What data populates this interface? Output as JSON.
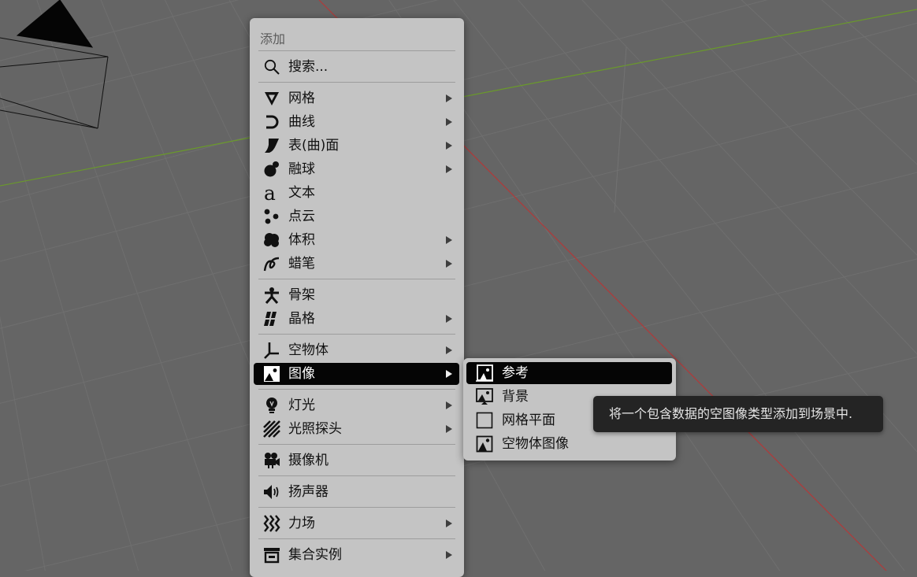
{
  "menu": {
    "title": "添加",
    "search_label": "搜索...",
    "items": [
      {
        "label": "网格",
        "icon": "mesh-icon",
        "has_submenu": true
      },
      {
        "label": "曲线",
        "icon": "curve-icon",
        "has_submenu": true
      },
      {
        "label": "表(曲)面",
        "icon": "surface-icon",
        "has_submenu": true
      },
      {
        "label": "融球",
        "icon": "metaball-icon",
        "has_submenu": true
      },
      {
        "label": "文本",
        "icon": "text-icon",
        "has_submenu": false
      },
      {
        "label": "点云",
        "icon": "pointcloud-icon",
        "has_submenu": false
      },
      {
        "label": "体积",
        "icon": "volume-icon",
        "has_submenu": true
      },
      {
        "label": "蜡笔",
        "icon": "grease-pencil-icon",
        "has_submenu": true
      },
      {
        "label": "骨架",
        "icon": "armature-icon",
        "has_submenu": false
      },
      {
        "label": "晶格",
        "icon": "lattice-icon",
        "has_submenu": true
      },
      {
        "label": "空物体",
        "icon": "empty-icon",
        "has_submenu": true
      },
      {
        "label": "图像",
        "icon": "image-icon",
        "has_submenu": true,
        "active": true
      },
      {
        "label": "灯光",
        "icon": "light-icon",
        "has_submenu": true
      },
      {
        "label": "光照探头",
        "icon": "light-probe-icon",
        "has_submenu": true
      },
      {
        "label": "摄像机",
        "icon": "camera-icon",
        "has_submenu": false
      },
      {
        "label": "扬声器",
        "icon": "speaker-icon",
        "has_submenu": false
      },
      {
        "label": "力场",
        "icon": "force-field-icon",
        "has_submenu": true
      },
      {
        "label": "集合实例",
        "icon": "collection-instance-icon",
        "has_submenu": true
      }
    ]
  },
  "image_submenu": {
    "items": [
      {
        "label": "参考",
        "icon": "image-reference-icon",
        "active": true
      },
      {
        "label": "背景",
        "icon": "image-background-icon"
      },
      {
        "label": "网格平面",
        "icon": "image-plane-icon"
      },
      {
        "label": "空物体图像",
        "icon": "image-empty-icon"
      }
    ]
  },
  "tooltip": {
    "text": "将一个包含数据的空图像类型添加到场景中."
  },
  "colors": {
    "viewport_background": "#656565",
    "menu_background": "#c4c4c4",
    "highlight": "#050505",
    "x_axis": "#b03a3a",
    "y_axis": "#6a9a2a",
    "tooltip_background": "#242424"
  }
}
